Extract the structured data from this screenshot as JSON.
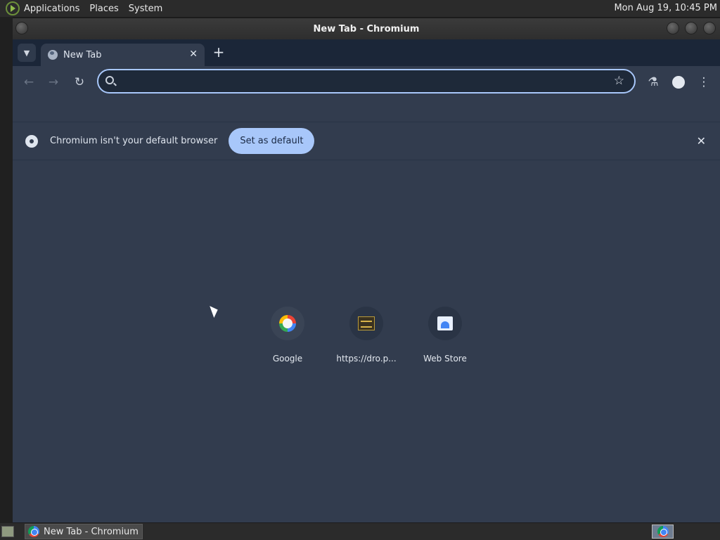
{
  "top_panel": {
    "menus": [
      "Applications",
      "Places",
      "System"
    ],
    "clock": "Mon Aug 19, 10:45 PM"
  },
  "window": {
    "title": "New Tab - Chromium"
  },
  "tabs": [
    {
      "label": "New Tab",
      "icon": "globe-icon",
      "active": true
    }
  ],
  "toolbar": {
    "omnibox_value": ""
  },
  "infobar": {
    "message": "Chromium isn't your default browser",
    "button_label": "Set as default"
  },
  "shortcuts": [
    {
      "label": "Google",
      "icon": "google-icon"
    },
    {
      "label": "https://dro.p...",
      "icon": "site-favicon-icon"
    },
    {
      "label": "Web Store",
      "icon": "web-store-icon"
    }
  ],
  "taskbar": {
    "task_label": "New Tab - Chromium"
  },
  "colors": {
    "accent": "#a8c7fa",
    "page_bg": "#323c4e",
    "tabstrip_bg": "#1b2638"
  }
}
